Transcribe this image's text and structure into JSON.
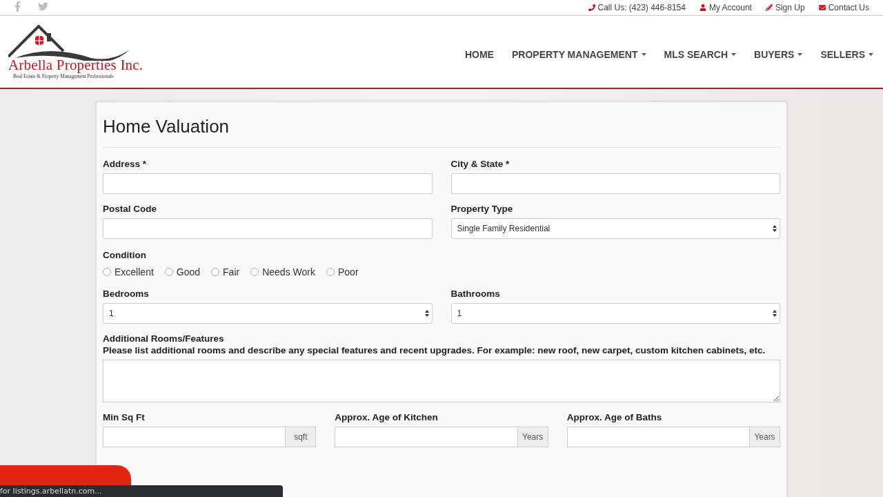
{
  "top_bar": {
    "links": [
      {
        "label": "Call Us: (423) 446-8154"
      },
      {
        "label": "My Account"
      },
      {
        "label": "Sign Up"
      },
      {
        "label": "Contact Us"
      }
    ]
  },
  "logo": {
    "name": "Arbella Properties Inc.",
    "tagline": "Real Estate & Property Management Professionals"
  },
  "nav": [
    {
      "label": "HOME",
      "dropdown": false
    },
    {
      "label": "PROPERTY MANAGEMENT",
      "dropdown": true
    },
    {
      "label": "MLS SEARCH",
      "dropdown": true
    },
    {
      "label": "BUYERS",
      "dropdown": true
    },
    {
      "label": "SELLERS",
      "dropdown": true
    }
  ],
  "form": {
    "title": "Home Valuation",
    "rows": [
      {
        "kind": "pair",
        "fields": [
          {
            "kind": "text",
            "label": "Address *"
          },
          {
            "kind": "text",
            "label": "City & State *"
          }
        ]
      },
      {
        "kind": "pair",
        "fields": [
          {
            "kind": "text",
            "label": "Postal Code"
          },
          {
            "kind": "select",
            "label": "Property Type",
            "value": "Single Family Residential"
          }
        ]
      },
      {
        "kind": "radios",
        "label": "Condition",
        "options": [
          {
            "label": "Excellent",
            "selected": false
          },
          {
            "label": "Good",
            "selected": false
          },
          {
            "label": "Fair",
            "selected": false
          },
          {
            "label": "Needs Work",
            "selected": false
          },
          {
            "label": "Poor",
            "selected": false
          }
        ]
      },
      {
        "kind": "pair",
        "fields": [
          {
            "kind": "select",
            "label": "Bedrooms",
            "value": "1"
          },
          {
            "kind": "select",
            "label": "Bathrooms",
            "value": "1"
          }
        ]
      },
      {
        "kind": "textarea",
        "label": "Additional Rooms/Features",
        "hint": "Please list additional rooms and describe any special features and recent upgrades. For example: new roof, new carpet, custom kitchen cabinets, etc."
      },
      {
        "kind": "triple",
        "fields": [
          {
            "label": "Min Sq Ft",
            "addon": "sqft"
          },
          {
            "label": "Approx. Age of Kitchen",
            "addon": "Years"
          },
          {
            "label": "Approx. Age of Baths",
            "addon": "Years"
          }
        ]
      }
    ]
  },
  "status_bar": {
    "text": "for listings.arbellatn.com..."
  }
}
